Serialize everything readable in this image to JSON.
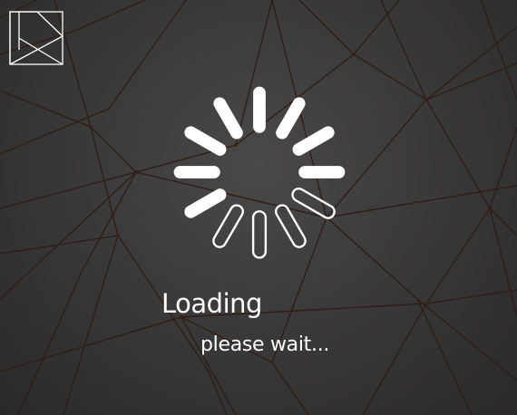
{
  "title": "Loading",
  "subtitle": "please wait...",
  "logo": {
    "icon": "k-monogram-logo"
  },
  "spinner": {
    "icon": "loading-spinner-icon",
    "bars": 12,
    "hollow_bars": 4
  },
  "colors": {
    "background": "#3a3939",
    "text": "#ffffff",
    "network_lines": "#3a2218",
    "spinner": "#ffffff"
  }
}
